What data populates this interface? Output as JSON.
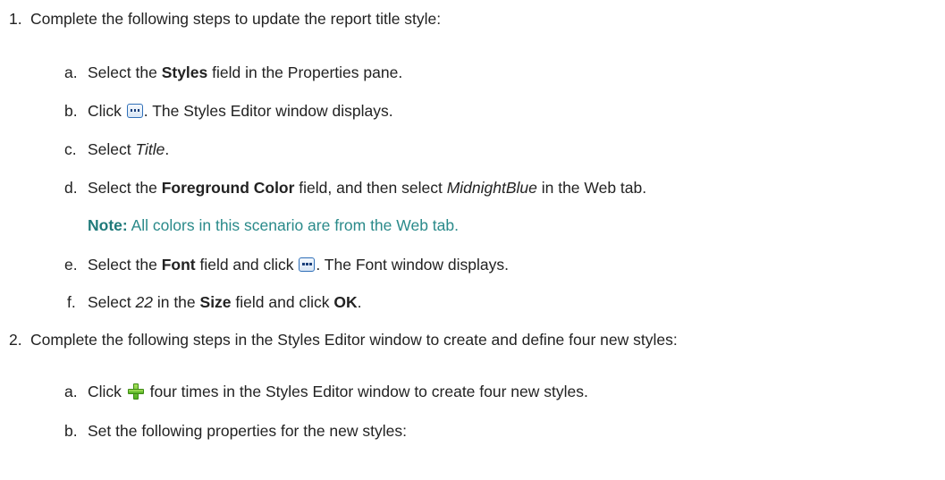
{
  "step1": {
    "number": "1.",
    "text": "Complete the following steps to update the report title style:",
    "substeps": {
      "a": {
        "letter": "a.",
        "pre": "Select the ",
        "bold": "Styles",
        "post": " field in the Properties pane."
      },
      "b": {
        "letter": "b.",
        "pre": "Click ",
        "icon": "ellipsis-button-icon",
        "post": ". The Styles Editor window displays."
      },
      "c": {
        "letter": "c.",
        "pre": "Select ",
        "italic": "Title",
        "post": "."
      },
      "d": {
        "letter": "d.",
        "pre": "Select the ",
        "bold": "Foreground Color",
        "mid": " field, and then select ",
        "italic": "MidnightBlue",
        "post": " in the Web tab."
      },
      "note": {
        "label": "Note:",
        "text": " All colors in this scenario are from the Web tab."
      },
      "e": {
        "letter": "e.",
        "pre": "Select the ",
        "bold": "Font",
        "mid": " field and click ",
        "icon": "ellipsis-button-icon",
        "post": ". The Font window displays."
      },
      "f": {
        "letter": "f.",
        "pre": "Select ",
        "italic": "22",
        "mid": " in the ",
        "bold": "Size",
        "mid2": " field and click ",
        "bold2": "OK",
        "post": "."
      }
    }
  },
  "step2": {
    "number": "2.",
    "text": "Complete the following steps in the Styles Editor window to create and define four new styles:",
    "substeps": {
      "a": {
        "letter": "a.",
        "pre": "Click ",
        "icon": "add-plus-icon",
        "post": " four times in the Styles Editor window to create four new styles."
      },
      "b": {
        "letter": "b.",
        "text": "Set the following properties for the new styles:"
      }
    }
  }
}
